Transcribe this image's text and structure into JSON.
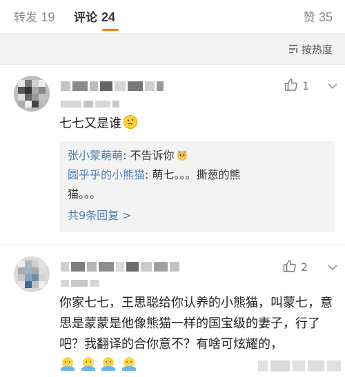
{
  "tabs": {
    "repost": {
      "label": "转发",
      "count": "19"
    },
    "comment": {
      "label": "评论",
      "count": "24"
    },
    "like": {
      "label": "赞",
      "count": "35"
    }
  },
  "sort": {
    "label": "按热度"
  },
  "comments": [
    {
      "like_count": "1",
      "text": "七七又是谁",
      "replies": [
        {
          "user": "张小蒙萌萌",
          "text": ": 不告诉你"
        },
        {
          "user": "圆乎乎的小熊猫",
          "text": ": 萌七。。。撕葱的熊",
          "text2": "猫。。。"
        }
      ],
      "more_replies": "共9条回复 >"
    },
    {
      "like_count": "2",
      "text": "你家七七，王思聪给你认养的小熊猫，叫蒙七，意思是蒙蒙是他像熊猫一样的国宝级的妻子，行了吧？我翻译的合你意不？有啥可炫耀的，"
    }
  ],
  "colors": {
    "accent": "#ff8200",
    "link": "#507daf",
    "bg_gray": "#f2f2f2"
  }
}
